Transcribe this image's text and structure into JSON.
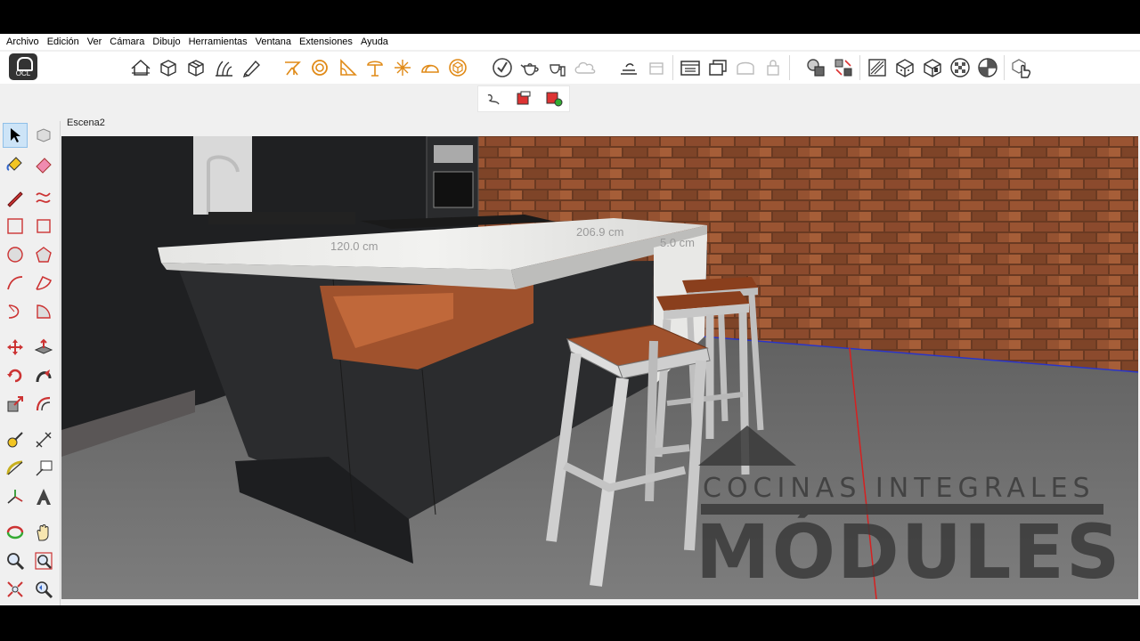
{
  "menubar": {
    "items": [
      "Archivo",
      "Edición",
      "Ver",
      "Cámara",
      "Dibujo",
      "Herramientas",
      "Ventana",
      "Extensiones",
      "Ayuda"
    ]
  },
  "logo": {
    "label": "OCL"
  },
  "scenes": {
    "active_tab": "Escena2"
  },
  "toolbar": {
    "icons": [
      "house-outline-icon",
      "box-icon",
      "box-stack-icon",
      "plants-icon",
      "pencil-cube-icon",
      "tripod-icon",
      "ring-icon",
      "slope-icon",
      "mushroom-lamp-icon",
      "spark-icon",
      "dome-icon",
      "orange-cube-icon",
      "check-circle-icon",
      "teapot-icon",
      "hand-cup-icon",
      "cloud-icon",
      "bird-icon",
      "window-icon",
      "stairs-icon",
      "frame-icon",
      "layers-icon",
      "door-icon",
      "lock-icon",
      "shapes-icon",
      "arrows-grid-icon",
      "brush-icon",
      "cube-dots-icon",
      "cube-hole-icon",
      "sphere-check-icon",
      "globe-grid-icon",
      "hand-pointer-icon"
    ]
  },
  "viewport": {
    "dimensions": [
      "120.0 cm",
      "206.9 cm",
      "5.0 cm"
    ],
    "watermark_line1": "COCINAS INTEGRALES",
    "watermark_line2": "MÓDULES"
  },
  "colors": {
    "brick": "#8a4a2c",
    "countertop": "#e8e8e6",
    "cabinet": "#2b2c2e",
    "wood": "#a0522d",
    "floor": "#777777",
    "axis_red": "#d62020",
    "axis_blue": "#2a35c8"
  }
}
